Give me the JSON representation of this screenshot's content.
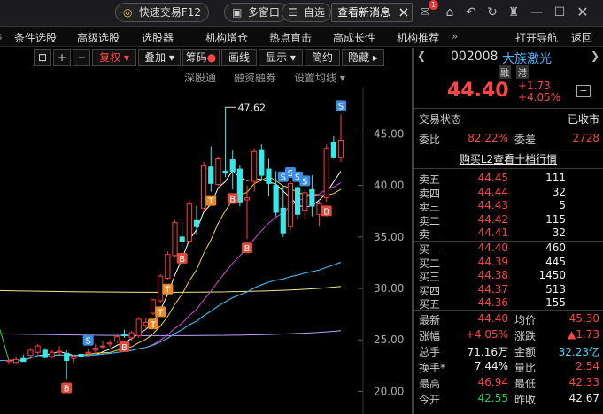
{
  "topbar": {
    "quick_trade": "快速交易F12",
    "multi_window": "多窗口",
    "self_select": "自选",
    "notice": "查看新消息",
    "notice_close": "×",
    "mail_badge": "1"
  },
  "menu": {
    "items": [
      "条件选股",
      "高级选股",
      "选股器",
      "机构增仓",
      "热点直击",
      "高成长性",
      "机构推荐"
    ],
    "more": "»",
    "right": [
      "打开导航",
      "返回"
    ]
  },
  "toolbar": {
    "fuquan": "复权",
    "overlay": "叠加",
    "chips": "筹码",
    "drawline": "画线",
    "display": "显示",
    "simple": "简约",
    "hide": "隐藏"
  },
  "subbar": {
    "shsz": "深股通",
    "margin": "融资融券",
    "ma_setting": "设置均线"
  },
  "chart_data": {
    "type": "candlestick",
    "max_label": "47.62",
    "y_ticks": [
      "45.00",
      "40.00",
      "35.00",
      "30.00",
      "25.00",
      "20.00"
    ],
    "ylim": [
      17.8,
      49.6
    ],
    "candles": [
      [
        22.9,
        23.1,
        22.7,
        23.0
      ],
      [
        22.8,
        23.3,
        22.6,
        23.1
      ],
      [
        23.2,
        23.6,
        22.9,
        22.9
      ],
      [
        23.5,
        24.2,
        23.3,
        24.0
      ],
      [
        23.8,
        24.6,
        23.6,
        24.4
      ],
      [
        24.0,
        24.2,
        23.2,
        23.3
      ],
      [
        23.4,
        24.0,
        23.2,
        23.8
      ],
      [
        23.8,
        24.4,
        23.5,
        23.9
      ],
      [
        23.7,
        24.0,
        21.2,
        23.0
      ],
      [
        23.2,
        23.6,
        22.8,
        23.4
      ],
      [
        23.6,
        23.8,
        23.2,
        23.4
      ],
      [
        23.7,
        24.1,
        23.4,
        23.8
      ],
      [
        24.0,
        24.6,
        23.8,
        24.2
      ],
      [
        24.4,
        24.9,
        24.1,
        24.4
      ],
      [
        24.6,
        25.0,
        24.3,
        24.7
      ],
      [
        24.9,
        25.6,
        24.7,
        25.3
      ],
      [
        25.5,
        26.0,
        25.2,
        25.4
      ],
      [
        25.2,
        25.9,
        24.9,
        25.7
      ],
      [
        25.4,
        27.2,
        25.2,
        27.0
      ],
      [
        26.4,
        27.1,
        26.0,
        26.7
      ],
      [
        27.6,
        29.0,
        27.4,
        28.9
      ],
      [
        28.8,
        31.4,
        28.6,
        31.2
      ],
      [
        31.0,
        33.6,
        30.8,
        33.3
      ],
      [
        33.2,
        36.6,
        33.0,
        36.4
      ],
      [
        35.0,
        36.4,
        33.8,
        34.6
      ],
      [
        34.6,
        38.6,
        34.4,
        38.2
      ],
      [
        36.6,
        38.0,
        35.2,
        36.0
      ],
      [
        37.8,
        42.3,
        37.6,
        41.9
      ],
      [
        41.8,
        43.8,
        39.4,
        40.2
      ],
      [
        40.1,
        42.8,
        40.0,
        42.6
      ],
      [
        41.4,
        47.6,
        40.8,
        41.2
      ],
      [
        42.5,
        43.4,
        39.6,
        41.4
      ],
      [
        41.6,
        42.0,
        38.0,
        38.4
      ],
      [
        38.6,
        40.0,
        34.8,
        38.8
      ],
      [
        40.4,
        43.6,
        39.4,
        43.3
      ],
      [
        43.4,
        44.0,
        40.6,
        41.0
      ],
      [
        41.6,
        42.6,
        39.0,
        40.2
      ],
      [
        40.0,
        41.4,
        37.0,
        37.4
      ],
      [
        37.8,
        40.0,
        35.0,
        35.4
      ],
      [
        36.0,
        40.4,
        35.6,
        40.2
      ],
      [
        39.8,
        40.0,
        36.8,
        37.2
      ],
      [
        37.6,
        39.6,
        36.8,
        39.3
      ],
      [
        39.6,
        41.0,
        37.0,
        38.0
      ],
      [
        37.2,
        38.6,
        36.0,
        38.2
      ],
      [
        38.8,
        44.0,
        38.4,
        43.6
      ],
      [
        44.2,
        44.8,
        42.6,
        42.7
      ],
      [
        42.7,
        46.9,
        42.3,
        44.4
      ]
    ],
    "markers": [
      {
        "t": "B",
        "i": 8
      },
      {
        "t": "S",
        "i": 11
      },
      {
        "t": "B",
        "i": 16
      },
      {
        "t": "T",
        "i": 20
      },
      {
        "t": "T",
        "i": 21
      },
      {
        "t": "T",
        "i": 22
      },
      {
        "t": "B",
        "i": 24
      },
      {
        "t": "T",
        "i": 28
      },
      {
        "t": "B",
        "i": 31
      },
      {
        "t": "B",
        "i": 33
      },
      {
        "t": "S",
        "i": 38
      },
      {
        "t": "S",
        "i": 39
      },
      {
        "t": "S",
        "i": 40
      },
      {
        "t": "S",
        "i": 41
      },
      {
        "t": "B",
        "i": 44
      },
      {
        "t": "S",
        "i": 46
      }
    ]
  },
  "panel": {
    "code": "002008",
    "name": "大族激光",
    "tags": [
      "融",
      "港"
    ],
    "price": "44.40",
    "change": "+1.73",
    "change_pct": "+4.05%",
    "status_label": "交易状态",
    "status_value": "已收市",
    "weibi_label": "委比",
    "weibi_value": "82.22%",
    "weicha_label": "委差",
    "weicha_value": "2728",
    "l2_link": "购买L2查看十档行情",
    "asks": [
      {
        "label": "卖五",
        "price": "44.45",
        "vol": "111"
      },
      {
        "label": "卖四",
        "price": "44.44",
        "vol": "32"
      },
      {
        "label": "卖三",
        "price": "44.43",
        "vol": "5"
      },
      {
        "label": "卖二",
        "price": "44.42",
        "vol": "115"
      },
      {
        "label": "卖一",
        "price": "44.41",
        "vol": "32"
      }
    ],
    "bids": [
      {
        "label": "买一",
        "price": "44.40",
        "vol": "460"
      },
      {
        "label": "买二",
        "price": "44.39",
        "vol": "445"
      },
      {
        "label": "买三",
        "price": "44.38",
        "vol": "1450"
      },
      {
        "label": "买四",
        "price": "44.37",
        "vol": "513"
      },
      {
        "label": "买五",
        "price": "44.36",
        "vol": "155"
      }
    ],
    "stats": [
      {
        "l1": "最新",
        "v1": "44.40",
        "c1": "red",
        "l2": "均价",
        "v2": "45.30",
        "c2": "red"
      },
      {
        "l1": "涨幅",
        "v1": "+4.05%",
        "c1": "red",
        "l2": "涨跌",
        "v2": "▲1.73",
        "c2": "red"
      },
      {
        "l1": "总手",
        "v1": "71.16万",
        "c1": "white",
        "l2": "金额",
        "v2": "32.23亿",
        "c2": "cyan"
      },
      {
        "l1": "换手*",
        "v1": "7.44%",
        "c1": "white",
        "l2": "量比",
        "v2": "2.54",
        "c2": "red"
      },
      {
        "l1": "最高",
        "v1": "46.94",
        "c1": "red",
        "l2": "最低",
        "v2": "42.33",
        "c2": "red"
      },
      {
        "l1": "今开",
        "v1": "42.55",
        "c1": "green",
        "l2": "昨收",
        "v2": "42.67",
        "c2": "white"
      }
    ]
  }
}
